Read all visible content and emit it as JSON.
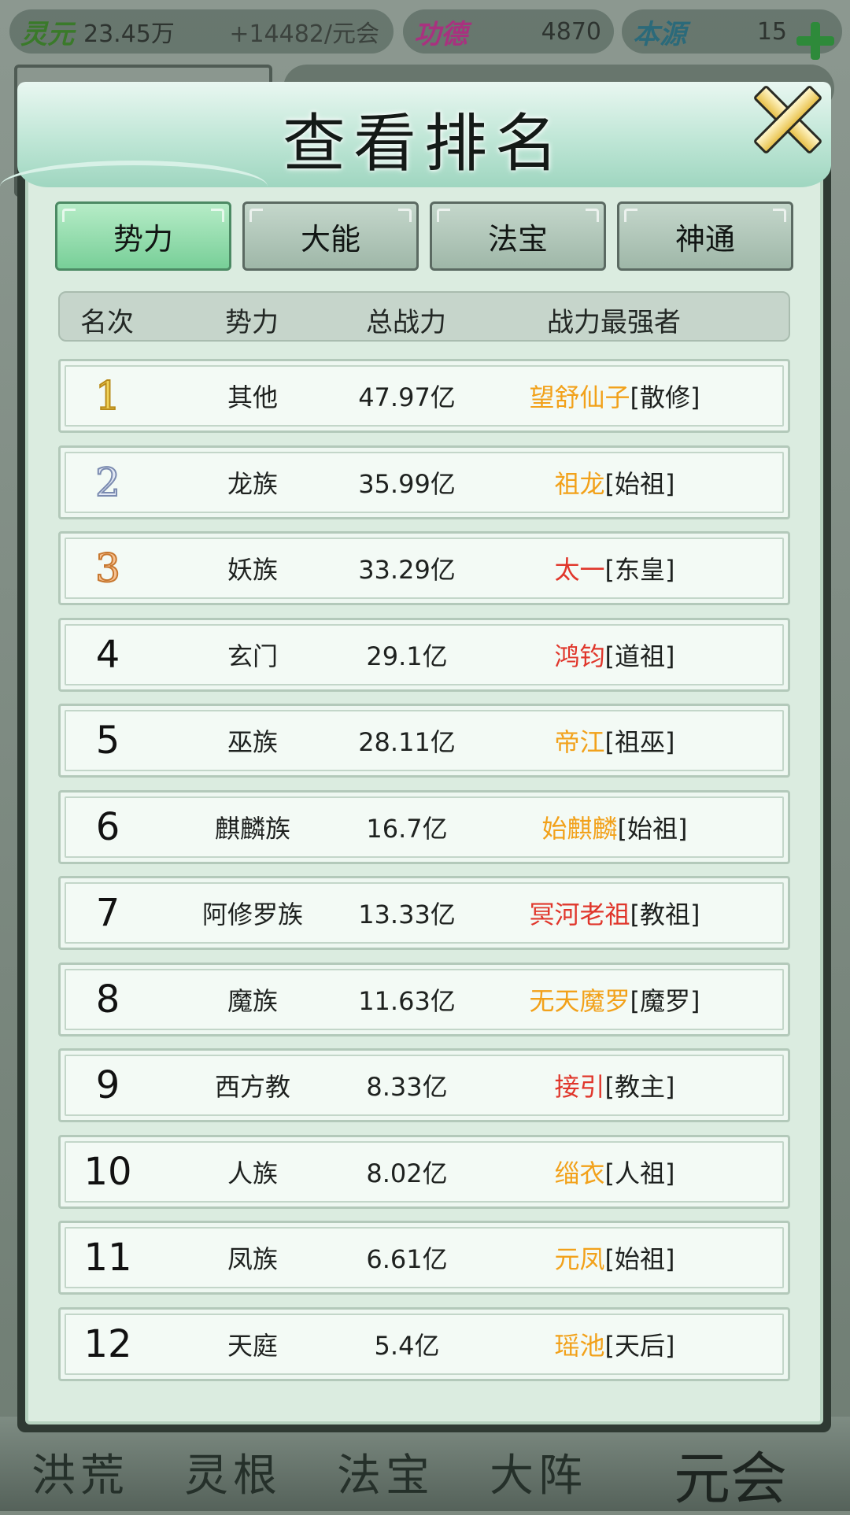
{
  "resources": {
    "lingyuan_label": "灵元",
    "lingyuan_value": "23.45万",
    "lingyuan_rate": "+14482/元会",
    "gongde_label": "功德",
    "gongde_value": "4870",
    "benyuan_label": "本源",
    "benyuan_value": "15"
  },
  "dialog": {
    "title": "查看排名",
    "tabs": [
      "势力",
      "大能",
      "法宝",
      "神通"
    ],
    "active_tab": "势力",
    "columns": [
      "名次",
      "势力",
      "总战力",
      "战力最强者"
    ],
    "rows": [
      {
        "rank": "1",
        "faction": "其他",
        "power": "47.97亿",
        "leader": "望舒仙子",
        "title": "[散修]",
        "leader_color": "#f2a11a"
      },
      {
        "rank": "2",
        "faction": "龙族",
        "power": "35.99亿",
        "leader": "祖龙",
        "title": "[始祖]",
        "leader_color": "#f2a11a"
      },
      {
        "rank": "3",
        "faction": "妖族",
        "power": "33.29亿",
        "leader": "太一",
        "title": "[东皇]",
        "leader_color": "#e0362b"
      },
      {
        "rank": "4",
        "faction": "玄门",
        "power": "29.1亿",
        "leader": "鸿钧",
        "title": "[道祖]",
        "leader_color": "#e0362b"
      },
      {
        "rank": "5",
        "faction": "巫族",
        "power": "28.11亿",
        "leader": "帝江",
        "title": "[祖巫]",
        "leader_color": "#f2a11a"
      },
      {
        "rank": "6",
        "faction": "麒麟族",
        "power": "16.7亿",
        "leader": "始麒麟",
        "title": "[始祖]",
        "leader_color": "#f2a11a"
      },
      {
        "rank": "7",
        "faction": "阿修罗族",
        "power": "13.33亿",
        "leader": "冥河老祖",
        "title": "[教祖]",
        "leader_color": "#e0362b"
      },
      {
        "rank": "8",
        "faction": "魔族",
        "power": "11.63亿",
        "leader": "无天魔罗",
        "title": "[魔罗]",
        "leader_color": "#f2a11a"
      },
      {
        "rank": "9",
        "faction": "西方教",
        "power": "8.33亿",
        "leader": "接引",
        "title": "[教主]",
        "leader_color": "#e0362b"
      },
      {
        "rank": "10",
        "faction": "人族",
        "power": "8.02亿",
        "leader": "缁衣",
        "title": "[人祖]",
        "leader_color": "#f2a11a"
      },
      {
        "rank": "11",
        "faction": "凤族",
        "power": "6.61亿",
        "leader": "元凤",
        "title": "[始祖]",
        "leader_color": "#f2a11a"
      },
      {
        "rank": "12",
        "faction": "天庭",
        "power": "5.4亿",
        "leader": "瑶池",
        "title": "[天后]",
        "leader_color": "#f2a11a"
      }
    ]
  },
  "bottom_nav": {
    "items": [
      "洪荒",
      "灵根",
      "法宝",
      "大阵"
    ],
    "yuanhui": "元会"
  }
}
